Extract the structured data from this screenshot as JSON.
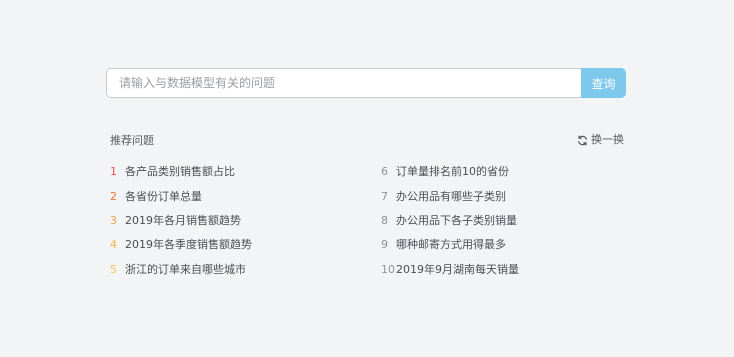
{
  "search": {
    "placeholder": "请输入与数据模型有关的问题",
    "button_label": "查询"
  },
  "recommendations": {
    "title": "推荐问题",
    "refresh_label": "换一换",
    "left": [
      {
        "num": "1",
        "text": "各产品类别销售额占比",
        "num_color": "#f04a4a"
      },
      {
        "num": "2",
        "text": "各省份订单总量",
        "num_color": "#f5703b"
      },
      {
        "num": "3",
        "text": "2019年各月销售额趋势",
        "num_color": "#f5a04a"
      },
      {
        "num": "4",
        "text": "2019年各季度销售额趋势",
        "num_color": "#f5b34a"
      },
      {
        "num": "5",
        "text": "浙江的订单来自哪些城市",
        "num_color": "#f7c85a"
      }
    ],
    "right": [
      {
        "num": "6",
        "text": "订单量排名前10的省份"
      },
      {
        "num": "7",
        "text": "办公用品有哪些子类别"
      },
      {
        "num": "8",
        "text": "办公用品下各子类别销量"
      },
      {
        "num": "9",
        "text": "哪种邮寄方式用得最多"
      },
      {
        "num": "10",
        "text": "2019年9月湖南每天销量"
      }
    ]
  },
  "colors": {
    "accent": "#7dc9ec",
    "background": "#f3f4f6"
  },
  "icons": {
    "refresh": "refresh-icon"
  }
}
